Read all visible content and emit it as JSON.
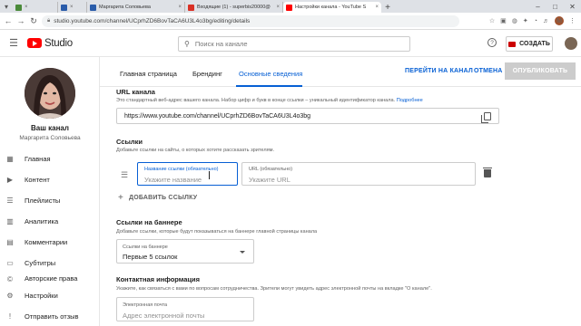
{
  "browser": {
    "tabs": [
      {
        "title": "Маргарита Соловьева",
        "favicon_color": "#2a5caa"
      },
      {
        "title": "Входящие (1) - superbis20000@",
        "favicon_color": "#d93025"
      },
      {
        "title": "Настройки канала - YouTube S",
        "favicon_color": "#ff0000"
      }
    ],
    "address": "studio.youtube.com/channel/UCprhZD6BovTaCA6U3L4o3bg/editing/details",
    "profile_letter": "M"
  },
  "header": {
    "logo_text": "Studio",
    "search_placeholder": "Поиск на канале",
    "help_icon": "?",
    "create_label": "СОЗДАТЬ"
  },
  "sidebar": {
    "channel_title": "Ваш канал",
    "channel_name": "Маргарита Соловьева",
    "items": [
      {
        "label": "Главная",
        "icon": "dashboard-icon"
      },
      {
        "label": "Контент",
        "icon": "video-icon"
      },
      {
        "label": "Плейлисты",
        "icon": "playlist-icon"
      },
      {
        "label": "Аналитика",
        "icon": "analytics-icon"
      },
      {
        "label": "Комментарии",
        "icon": "comments-icon"
      },
      {
        "label": "Субтитры",
        "icon": "subtitles-icon"
      },
      {
        "label": "Авторские права",
        "icon": "copyright-icon"
      },
      {
        "label": "Настройки",
        "icon": "gear-icon"
      },
      {
        "label": "Отправить отзыв",
        "icon": "feedback-icon"
      }
    ]
  },
  "tabs": {
    "home": "Главная страница",
    "branding": "Брендинг",
    "basic": "Основные сведения",
    "go_to_channel": "ПЕРЕЙТИ НА КАНАЛ",
    "cancel": "ОТМЕНА",
    "publish": "ОПУБЛИКОВАТЬ"
  },
  "url_section": {
    "title": "URL канала",
    "desc": "Это стандартный веб-адрес вашего канала. Набор цифр и букв в конце ссылки – уникальный идентификатор канала.",
    "more_link": "Подробнее",
    "value": "https://www.youtube.com/channel/UCprhZD6BovTaCA6U3L4o3bg"
  },
  "links_section": {
    "title": "Ссылки",
    "desc": "Добавьте ссылки на сайты, о которых хотите рассказать зрителям.",
    "name_label": "Название ссылки (обязательно)",
    "name_placeholder": "Укажите название",
    "url_label": "URL (обязательно)",
    "url_placeholder": "Укажите URL",
    "add_label": "ДОБАВИТЬ ССЫЛКУ"
  },
  "banner_section": {
    "title": "Ссылки на баннере",
    "desc": "Добавьте ссылки, которые будут показываться на баннере главной страницы канала",
    "select_label": "Ссылки на баннере",
    "select_value": "Первые 5 ссылок"
  },
  "contact_section": {
    "title": "Контактная информация",
    "desc": "Укажите, как связаться с вами по вопросам сотрудничества. Зрители могут увидеть адрес электронной почты на вкладке \"О канале\".",
    "email_label": "Электронная почта",
    "email_placeholder": "Адрес электронной почты"
  }
}
